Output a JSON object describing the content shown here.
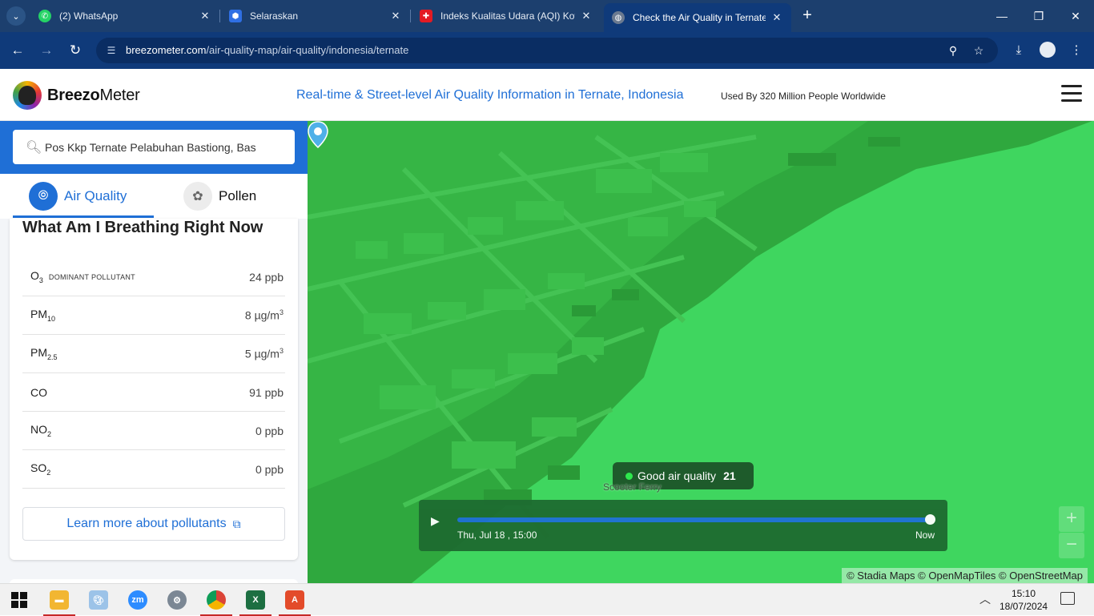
{
  "browser": {
    "tabs": [
      {
        "title": "(2) WhatsApp",
        "favicon_color": "#25d366",
        "icon": "whatsapp-icon"
      },
      {
        "title": "Selaraskan",
        "favicon_color": "#2f6fe4",
        "icon": "selaraskan-icon"
      },
      {
        "title": "Indeks Kualitas Udara (AQI) Kot",
        "favicon_color": "#e31b23",
        "icon": "swiss-flag-icon"
      },
      {
        "title": "Check the Air Quality in Ternate",
        "favicon_color": "#6b7a90",
        "icon": "globe-icon",
        "active": true
      }
    ],
    "url_host": "breezometer.com",
    "url_path": "/air-quality-map/air-quality/indonesia/ternate"
  },
  "site": {
    "logo_bold": "Breezo",
    "logo_rest": "Meter",
    "tagline": "Real-time & Street-level Air Quality Information in Ternate, Indonesia",
    "used_by": "Used By 320 Million People Worldwide",
    "brand_color": "#1f6fd6"
  },
  "sidebar": {
    "search_value": "Pos Kkp Ternate Pelabuhan Bastiong, Bas",
    "tabs": [
      {
        "label": "Air Quality",
        "selected": true
      },
      {
        "label": "Pollen",
        "selected": false
      }
    ],
    "heading": "What Am I Breathing Right Now",
    "pollutants": [
      {
        "name": "O",
        "sub": "3",
        "dominant": "DOMINANT POLLUTANT",
        "value": "24 ppb"
      },
      {
        "name": "PM",
        "sub": "10",
        "value": "8 µg/m",
        "sup": "3"
      },
      {
        "name": "PM",
        "sub": "2.5",
        "value": "5 µg/m",
        "sup": "3"
      },
      {
        "name": "CO",
        "value": "91 ppb"
      },
      {
        "name": "NO",
        "sub": "2",
        "value": "0 ppb"
      },
      {
        "name": "SO",
        "sub": "2",
        "value": "0 ppb"
      }
    ],
    "learn_more": "Learn more about pollutants"
  },
  "map": {
    "aqi_label": "Good air quality",
    "aqi_value": "21",
    "place_label": "Scooter Ferry",
    "timeline_date": "Thu, Jul 18 , 15:00",
    "timeline_now": "Now",
    "timeline_progress": 1.0,
    "attribution": "© Stadia Maps © OpenMapTiles © OpenStreetMap",
    "zoom_in": "+",
    "zoom_out": "−",
    "aqi_color": "#3fd65f"
  },
  "taskbar": {
    "apps": [
      "file-explorer-icon",
      "paint-icon",
      "zoom-icon",
      "settings-icon",
      "chrome-icon",
      "excel-icon",
      "acrobat-icon"
    ],
    "time": "15:10",
    "date": "18/07/2024"
  }
}
